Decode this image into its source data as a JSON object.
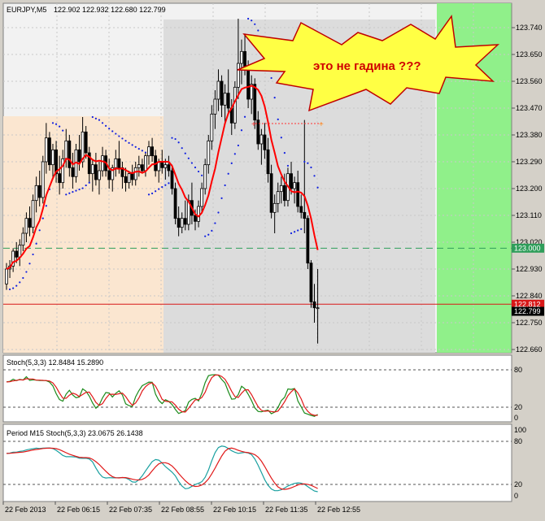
{
  "header": {
    "symbol_tf": "EURJPY,M5",
    "ohlc": "122.902 122.932 122.680 122.799"
  },
  "callout": {
    "text": "это не гадина ???"
  },
  "colors": {
    "zone_beige": "#fbe6d0",
    "zone_gray": "#dcdcdc",
    "zone_green": "#90f08a",
    "zone_white": "#f2f2f2",
    "ma_line": "#ff0000",
    "sar_dots": "#1020e0",
    "target_line": "#2e9e5a",
    "price_line": "#d81818",
    "stoch_main": "#1a8a1a",
    "stoch_signal": "#e01818",
    "stoch15_main": "#1aa0a0",
    "stoch15_signal": "#e01818",
    "callout_fill": "#ffff44"
  },
  "price_axis": {
    "ticks": [
      "123.740",
      "123.650",
      "123.560",
      "123.470",
      "123.380",
      "123.290",
      "123.200",
      "123.110",
      "123.020",
      "122.930",
      "122.840",
      "122.750",
      "122.660"
    ],
    "target_label": "123.000",
    "target_value": 123.0,
    "red_label": "122.812",
    "red_value": 122.812,
    "current_label": "122.799",
    "current_value": 122.799
  },
  "stoch_panel": {
    "title": "Stoch(5,3,3) 12.8484 15.2890",
    "levels": [
      "80",
      "20",
      "0"
    ]
  },
  "stoch15_panel": {
    "title": "Period M15 Stoch(5,3,3) 23.0675 26.1438",
    "levels": [
      "100",
      "80",
      "20",
      "0"
    ]
  },
  "time_axis": {
    "labels": [
      "22 Feb 2013",
      "22 Feb 06:15",
      "22 Feb 07:35",
      "22 Feb 08:55",
      "22 Feb 10:15",
      "22 Feb 11:35",
      "22 Feb 12:55"
    ]
  },
  "chart_data": {
    "type": "candlestick",
    "title": "EURJPY,M5",
    "ylim": [
      122.66,
      123.76
    ],
    "ohlc": [
      [
        122.88,
        122.95,
        122.86,
        122.93
      ],
      [
        122.93,
        122.96,
        122.9,
        122.94
      ],
      [
        122.94,
        123.0,
        122.92,
        122.99
      ],
      [
        122.99,
        123.02,
        122.95,
        122.97
      ],
      [
        122.97,
        123.03,
        122.94,
        123.01
      ],
      [
        123.01,
        123.07,
        122.99,
        123.05
      ],
      [
        123.05,
        123.12,
        123.02,
        123.1
      ],
      [
        123.1,
        123.14,
        123.04,
        123.07
      ],
      [
        123.07,
        123.18,
        123.05,
        123.16
      ],
      [
        123.16,
        123.24,
        123.12,
        123.21
      ],
      [
        123.21,
        123.26,
        123.14,
        123.17
      ],
      [
        123.17,
        123.31,
        123.15,
        123.29
      ],
      [
        123.29,
        123.42,
        123.25,
        123.37
      ],
      [
        123.37,
        123.39,
        123.26,
        123.28
      ],
      [
        123.28,
        123.35,
        123.23,
        123.33
      ],
      [
        123.33,
        123.36,
        123.22,
        123.25
      ],
      [
        123.25,
        123.31,
        123.18,
        123.22
      ],
      [
        123.22,
        123.33,
        123.2,
        123.3
      ],
      [
        123.3,
        123.4,
        123.27,
        123.36
      ],
      [
        123.36,
        123.38,
        123.24,
        123.27
      ],
      [
        123.27,
        123.32,
        123.2,
        123.24
      ],
      [
        123.24,
        123.35,
        123.22,
        123.33
      ],
      [
        123.33,
        123.38,
        123.26,
        123.29
      ],
      [
        123.29,
        123.44,
        123.27,
        123.39
      ],
      [
        123.39,
        123.41,
        123.3,
        123.32
      ],
      [
        123.32,
        123.34,
        123.22,
        123.25
      ],
      [
        123.25,
        123.3,
        123.19,
        123.28
      ],
      [
        123.28,
        123.32,
        123.21,
        123.23
      ],
      [
        123.23,
        123.29,
        123.18,
        123.26
      ],
      [
        123.26,
        123.34,
        123.24,
        123.31
      ],
      [
        123.31,
        123.33,
        123.24,
        123.26
      ],
      [
        123.26,
        123.3,
        123.2,
        123.23
      ],
      [
        123.23,
        123.28,
        123.19,
        123.27
      ],
      [
        123.27,
        123.33,
        123.24,
        123.3
      ],
      [
        123.3,
        123.36,
        123.25,
        123.27
      ],
      [
        123.27,
        123.29,
        123.2,
        123.24
      ],
      [
        123.24,
        123.27,
        123.19,
        123.22
      ],
      [
        123.22,
        123.26,
        123.2,
        123.25
      ],
      [
        123.25,
        123.28,
        123.21,
        123.23
      ],
      [
        123.23,
        123.29,
        123.21,
        123.27
      ],
      [
        123.27,
        123.31,
        123.24,
        123.28
      ],
      [
        123.28,
        123.3,
        123.25,
        123.26
      ],
      [
        123.26,
        123.32,
        123.24,
        123.31
      ],
      [
        123.31,
        123.36,
        123.28,
        123.34
      ],
      [
        123.34,
        123.37,
        123.29,
        123.31
      ],
      [
        123.31,
        123.33,
        123.24,
        123.26
      ],
      [
        123.26,
        123.3,
        123.22,
        123.29
      ],
      [
        123.29,
        123.33,
        123.25,
        123.27
      ],
      [
        123.27,
        123.3,
        123.23,
        123.28
      ],
      [
        123.28,
        123.31,
        123.24,
        123.26
      ],
      [
        123.26,
        123.28,
        123.18,
        123.2
      ],
      [
        123.2,
        123.22,
        123.08,
        123.1
      ],
      [
        123.1,
        123.14,
        123.04,
        123.07
      ],
      [
        123.07,
        123.12,
        123.05,
        123.1
      ],
      [
        123.1,
        123.16,
        123.06,
        123.08
      ],
      [
        123.08,
        123.18,
        123.06,
        123.16
      ],
      [
        123.16,
        123.22,
        123.08,
        123.11
      ],
      [
        123.11,
        123.13,
        123.06,
        123.09
      ],
      [
        123.09,
        123.16,
        123.07,
        123.14
      ],
      [
        123.14,
        123.22,
        123.12,
        123.2
      ],
      [
        123.2,
        123.3,
        123.18,
        123.28
      ],
      [
        123.28,
        123.38,
        123.25,
        123.36
      ],
      [
        123.36,
        123.48,
        123.33,
        123.45
      ],
      [
        123.45,
        123.53,
        123.4,
        123.5
      ],
      [
        123.5,
        123.6,
        123.46,
        123.56
      ],
      [
        123.56,
        123.58,
        123.44,
        123.48
      ],
      [
        123.48,
        123.55,
        123.42,
        123.52
      ],
      [
        123.52,
        123.6,
        123.45,
        123.47
      ],
      [
        123.47,
        123.5,
        123.38,
        123.42
      ],
      [
        123.42,
        123.56,
        123.4,
        123.54
      ],
      [
        123.54,
        123.77,
        123.5,
        123.62
      ],
      [
        123.62,
        123.7,
        123.55,
        123.66
      ],
      [
        123.66,
        123.72,
        123.58,
        123.6
      ],
      [
        123.6,
        123.63,
        123.47,
        123.5
      ],
      [
        123.5,
        123.58,
        123.45,
        123.55
      ],
      [
        123.55,
        123.57,
        123.4,
        123.43
      ],
      [
        123.43,
        123.46,
        123.33,
        123.35
      ],
      [
        123.35,
        123.4,
        123.28,
        123.38
      ],
      [
        123.38,
        123.42,
        123.3,
        123.33
      ],
      [
        123.33,
        123.37,
        123.22,
        123.25
      ],
      [
        123.25,
        123.28,
        123.1,
        123.12
      ],
      [
        123.12,
        123.18,
        123.05,
        123.15
      ],
      [
        123.15,
        123.22,
        123.12,
        123.19
      ],
      [
        123.19,
        123.24,
        123.15,
        123.21
      ],
      [
        123.21,
        123.25,
        123.14,
        123.16
      ],
      [
        123.16,
        123.27,
        123.14,
        123.25
      ],
      [
        123.25,
        123.29,
        123.18,
        123.2
      ],
      [
        123.2,
        123.24,
        123.15,
        123.22
      ],
      [
        123.22,
        123.26,
        123.12,
        123.14
      ],
      [
        123.14,
        123.18,
        123.1,
        123.12
      ],
      [
        123.12,
        123.43,
        123.05,
        123.1
      ],
      [
        123.1,
        123.11,
        122.93,
        122.95
      ],
      [
        122.95,
        122.96,
        122.8,
        122.82
      ],
      [
        122.82,
        122.88,
        122.75,
        122.8
      ],
      [
        122.8,
        122.93,
        122.68,
        122.8
      ]
    ]
  }
}
